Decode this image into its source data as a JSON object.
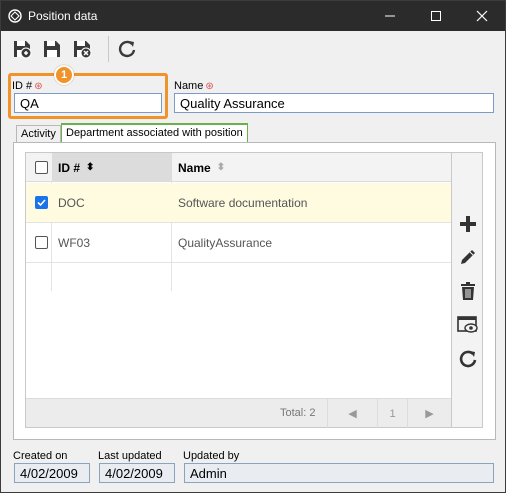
{
  "window": {
    "title": "Position data"
  },
  "toolbar": {
    "buttons": [
      "save-and-new-icon",
      "save-icon",
      "save-and-close-icon",
      "refresh-icon"
    ]
  },
  "form": {
    "id_label": "ID #",
    "id_value": "QA",
    "name_label": "Name",
    "name_value": "Quality Assurance",
    "required_mark": "⊛"
  },
  "callout": {
    "number": "1",
    "color": "#f0932b"
  },
  "tabs": [
    {
      "label": "Activity"
    },
    {
      "label": "Department associated with position"
    }
  ],
  "grid": {
    "columns": [
      {
        "label": "ID #",
        "sort": "⬍"
      },
      {
        "label": "Name",
        "sort": "⬍"
      }
    ],
    "rows": [
      {
        "checked": true,
        "id": "DOC",
        "name": "Software documentation"
      },
      {
        "checked": false,
        "id": "WF03",
        "name": "QualityAssurance"
      }
    ],
    "footer": {
      "total": "Total: 2",
      "page": "1",
      "prev": "◀",
      "next": "▶"
    }
  },
  "side_tools": [
    "add-icon",
    "edit-icon",
    "delete-icon",
    "view-icon",
    "refresh-icon"
  ],
  "footer_fields": {
    "created_on_label": "Created on",
    "created_on_value": "4/02/2009",
    "last_updated_label": "Last updated",
    "last_updated_value": "4/02/2009",
    "updated_by_label": "Updated by",
    "updated_by_value": "Admin"
  },
  "colors": {
    "titlebar": "#2b2b2b",
    "accent": "#f0932b",
    "tab_active": "#6ab04c",
    "selected_row": "#fefbe0",
    "checkbox_checked": "#1a73e8"
  }
}
